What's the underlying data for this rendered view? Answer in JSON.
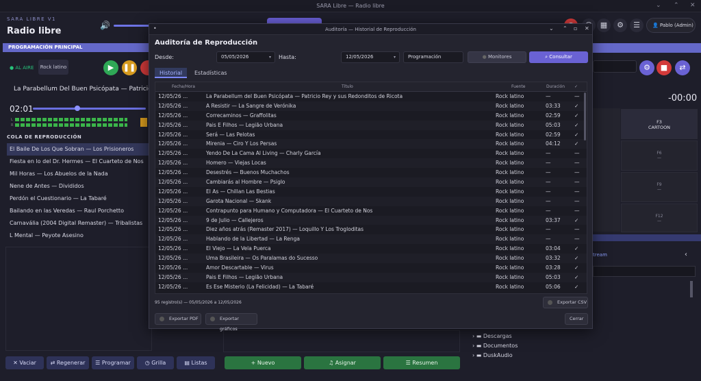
{
  "window": {
    "title": "SARA Libre — Radio libre"
  },
  "app": {
    "name": "SARA LIBRE V1",
    "title": "Radio libre",
    "user": "Pablo (Admin)"
  },
  "left": {
    "section": "PROGRAMACIÓN PRINCIPAL",
    "on_air": "● AL AIRE",
    "genre": "Rock latino",
    "now_playing": "La Parabellum Del Buen Psicópata — Patricio Rey y su",
    "time": "02:01",
    "queue_title": "COLA DE REPRODUCCIÓN",
    "queue": [
      "El Baile De Los Que Sobran — Los Prisioneros",
      "Fiesta en lo del Dr. Hermes — El Cuarteto de Nos",
      "Mil Horas — Los Abuelos de la Nada",
      "Nene de Antes — Divididos",
      "Perdón el Cuestionario — La Tabaré",
      "Bailando en las Veredas — Raul Porchetto",
      "Carnavália (2004 Digital Remaster) — Tribalistas",
      "L Mental — Peyote Asesino"
    ],
    "buttons": [
      "Vaciar",
      "Regenerar",
      "Programar",
      "Grilla",
      "Listas"
    ]
  },
  "center_buttons": [
    "Nuevo",
    "Asignar",
    "Resumen"
  ],
  "right": {
    "timer": "-00:00",
    "fkeys": [
      {
        "key": "F3",
        "label": "CARTOON"
      },
      {
        "key": "F6",
        "label": "—"
      },
      {
        "key": "F9",
        "label": "—"
      },
      {
        "key": "F12",
        "label": "—"
      }
    ],
    "stream": "tream",
    "tree": [
      "Descargas",
      "Documentos",
      "DuskAudio"
    ]
  },
  "dialog": {
    "title": "Auditoría — Historial de Reproducción",
    "heading": "Auditoría de Reproducción",
    "desde_label": "Desde:",
    "desde": "05/05/2026",
    "hasta_label": "Hasta:",
    "hasta": "12/05/2026",
    "tipo": "Programación",
    "monitores": "Monitores",
    "consultar": "Consultar",
    "tabs": [
      "Historial",
      "Estadísticas"
    ],
    "columns": [
      "Fecha/Hora",
      "Título",
      "Fuente",
      "Duración",
      "✓"
    ],
    "rows": [
      [
        "12/05/26 ...",
        "La Parabellum del Buen Psicópata — Patricio Rey y sus Redonditos de Ricota",
        "Rock latino",
        "—",
        "—"
      ],
      [
        "12/05/26 ...",
        "A Resistir — La Sangre de Verónika",
        "Rock latino",
        "03:33",
        "✓"
      ],
      [
        "12/05/26 ...",
        "Correcaminos — Graffolitas",
        "Rock latino",
        "02:59",
        "✓"
      ],
      [
        "12/05/26 ...",
        "Pais E Filhos — Legião Urbana",
        "Rock latino",
        "05:03",
        "✓"
      ],
      [
        "12/05/26 ...",
        "Será — Las Pelotas",
        "Rock latino",
        "02:59",
        "✓"
      ],
      [
        "12/05/26 ...",
        "Mirenia — Ciro Y Los Persas",
        "Rock latino",
        "04:12",
        "✓"
      ],
      [
        "12/05/26 ...",
        "Yendo De La Cama Al Living — Charly García",
        "Rock latino",
        "—",
        "—"
      ],
      [
        "12/05/26 ...",
        "Homero — Viejas Locas",
        "Rock latino",
        "—",
        "—"
      ],
      [
        "12/05/26 ...",
        "Desestrés — Buenos Muchachos",
        "Rock latino",
        "—",
        "—"
      ],
      [
        "12/05/26 ...",
        "Cambiarás al Hombre — Psiglo",
        "Rock latino",
        "—",
        "—"
      ],
      [
        "12/05/26 ...",
        "El As — Chillan Las Bestias",
        "Rock latino",
        "—",
        "—"
      ],
      [
        "12/05/26 ...",
        "Garota Nacional — Skank",
        "Rock latino",
        "—",
        "—"
      ],
      [
        "12/05/26 ...",
        "Contrapunto para Humano y Computadora — El Cuarteto de Nos",
        "Rock latino",
        "—",
        "—"
      ],
      [
        "12/05/26 ...",
        "9 de Julio — Callejeros",
        "Rock latino",
        "03:37",
        "✓"
      ],
      [
        "12/05/26 ...",
        "Diez años atrás (Remaster 2017) — Loquillo Y Los Trogloditas",
        "Rock latino",
        "—",
        "—"
      ],
      [
        "12/05/26 ...",
        "Hablando de la Libertad — La Renga",
        "Rock latino",
        "—",
        "—"
      ],
      [
        "12/05/26 ...",
        "El Viejo — La Vela Puerca",
        "Rock latino",
        "03:04",
        "✓"
      ],
      [
        "12/05/26 ...",
        "Uma Brasileira — Os Paralamas do Sucesso",
        "Rock latino",
        "03:32",
        "✓"
      ],
      [
        "12/05/26 ...",
        "Amor Descartable — Virus",
        "Rock latino",
        "03:28",
        "✓"
      ],
      [
        "12/05/26 ...",
        "Pais E Filhos — Legião Urbana",
        "Rock latino",
        "05:03",
        "✓"
      ],
      [
        "12/05/26 ...",
        "Es Ese Misterio (La Felicidad) — La Tabaré",
        "Rock latino",
        "05:06",
        "✓"
      ]
    ],
    "footer": "95 registro(s) — 05/05/2026 a 12/05/2026",
    "export_csv": "Exportar CSV",
    "export_pdf": "Exportar PDF",
    "export_graphs": "Exportar gráficos",
    "close": "Cerrar"
  }
}
